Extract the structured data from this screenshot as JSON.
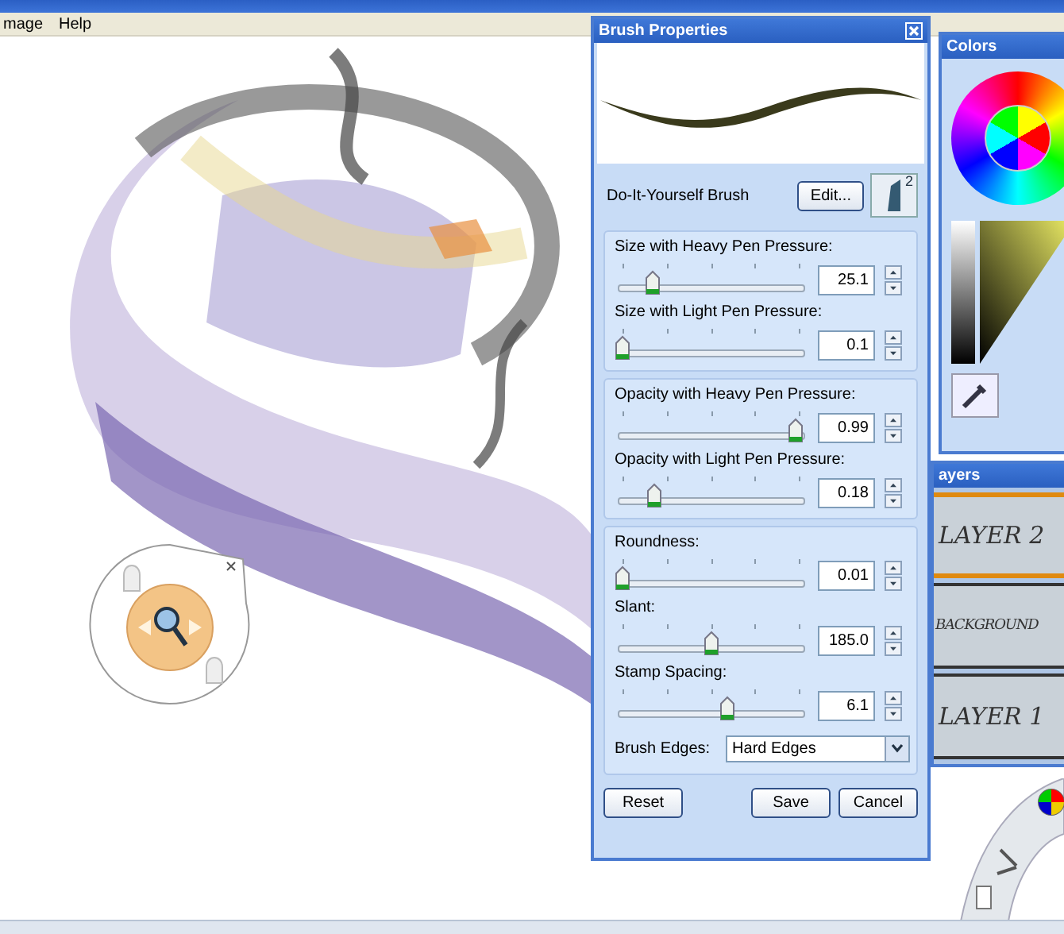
{
  "menu": [
    {
      "label": "mage"
    },
    {
      "label": "Help"
    }
  ],
  "brush_properties": {
    "title": "Brush Properties",
    "brush_name": "Do-It-Yourself Brush",
    "edit_button": "Edit...",
    "brush_badge": "2",
    "groups": [
      {
        "sliders": [
          {
            "label": "Size with Heavy Pen Pressure:",
            "level": 0.17,
            "value": "25.1"
          },
          {
            "label": "Size with Light Pen Pressure:",
            "level": 0.0,
            "value": "0.1"
          }
        ]
      },
      {
        "sliders": [
          {
            "label": "Opacity with Heavy Pen Pressure:",
            "level": 0.97,
            "value": "0.99"
          },
          {
            "label": "Opacity with Light Pen Pressure:",
            "level": 0.18,
            "value": "0.18"
          }
        ]
      },
      {
        "sliders": [
          {
            "label": "Roundness:",
            "level": 0.0,
            "value": "0.01"
          },
          {
            "label": "Slant:",
            "level": 0.5,
            "value": "185.0"
          },
          {
            "label": "Stamp Spacing:",
            "level": 0.59,
            "value": "6.1"
          }
        ]
      }
    ],
    "edges": {
      "label": "Brush Edges:",
      "value": "Hard Edges"
    },
    "buttons": [
      {
        "label": "Reset"
      },
      {
        "label": "Save"
      },
      {
        "label": "Cancel"
      }
    ]
  },
  "colors": {
    "title": "Colors"
  },
  "layers": {
    "title": "ayers",
    "items": [
      {
        "name": "LAYER 2",
        "selected": true
      },
      {
        "name": "BACKGROUND",
        "selected": false
      },
      {
        "name": "LAYER 1",
        "selected": false
      }
    ]
  }
}
